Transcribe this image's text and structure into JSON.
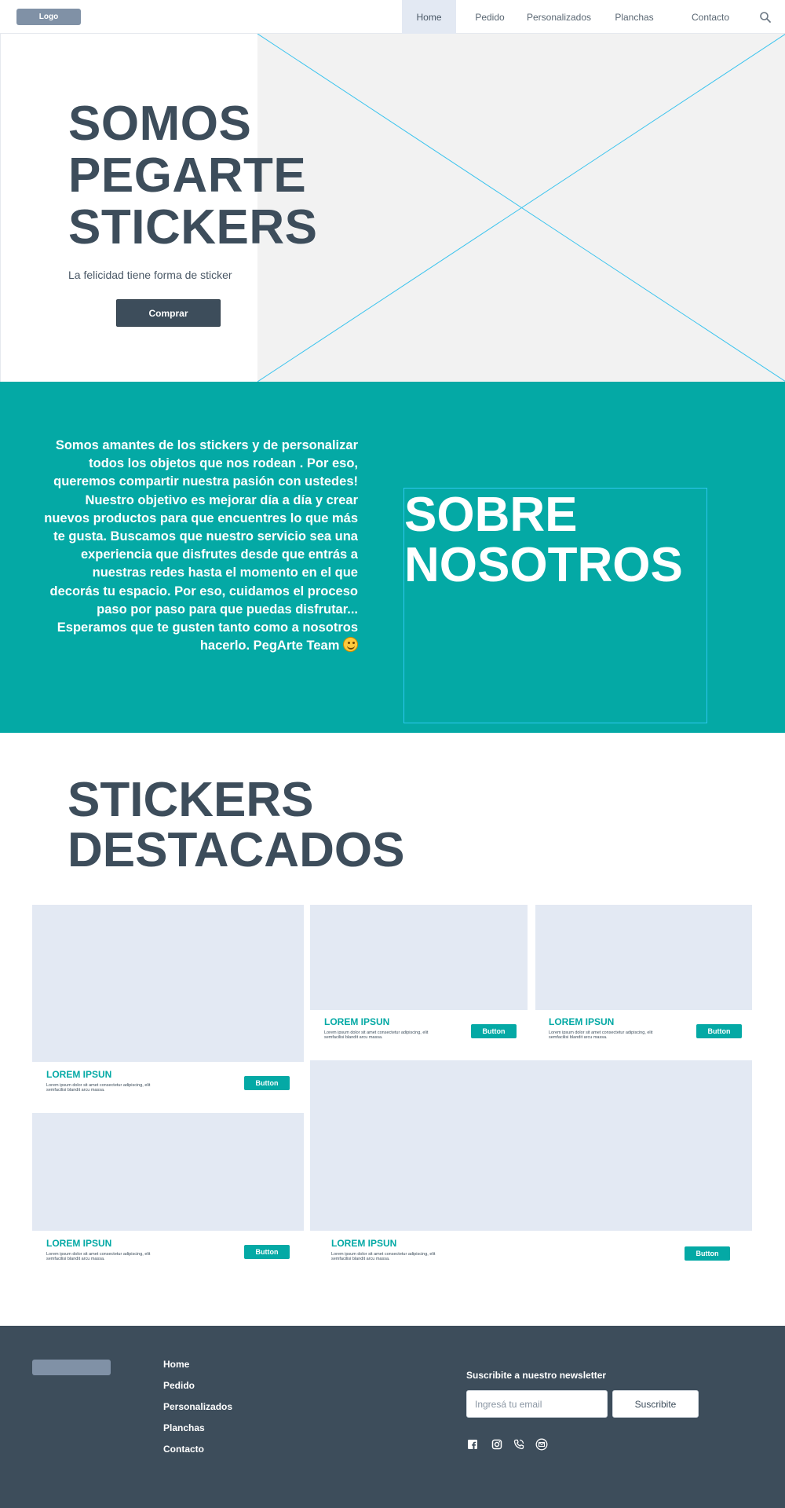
{
  "nav": {
    "logo": "Logo",
    "items": [
      {
        "label": "Home",
        "active": true
      },
      {
        "label": "Pedido",
        "active": false
      },
      {
        "label": "Personalizados",
        "active": false
      },
      {
        "label": "Planchas",
        "active": false
      },
      {
        "label": "Contacto",
        "active": false
      }
    ],
    "search_icon": "search-icon"
  },
  "hero": {
    "title_lines": [
      "SOMOS",
      "PEGARTE",
      "STICKERS"
    ],
    "subtitle": "La felicidad tiene forma de sticker",
    "button": "Comprar"
  },
  "about": {
    "text": "Somos amantes de los stickers y de personalizar todos los objetos que nos rodean . Por eso, queremos compartir nuestra pasión con ustedes! Nuestro objetivo es mejorar día a día y crear nuevos productos para que encuentres lo que más te gusta. Buscamos que nuestro servicio sea una experiencia que disfrutes desde que entrás a nuestras redes hasta el momento en el que decorás tu espacio. Por eso, cuidamos el proceso paso por paso para que puedas disfrutar... Esperamos que te gusten tanto como a nosotros hacerlo. PegArte Team",
    "title_lines": [
      "SOBRE",
      "NOSOTROS"
    ],
    "emoji_icon": "smiley-icon"
  },
  "featured": {
    "title_lines": [
      "STICKERS",
      "DESTACADOS"
    ],
    "cards": [
      {
        "title": "LOREM IPSUN",
        "desc": "Lorem ipsum dolor sit amet consectetur adipiscing, elit semfacilisi blandit arcu massa.",
        "button": "Button"
      },
      {
        "title": "LOREM IPSUN",
        "desc": "Lorem ipsum dolor sit amet consectetur adipiscing, elit semfacilisi blandit arcu massa.",
        "button": "Button"
      },
      {
        "title": "LOREM IPSUN",
        "desc": "Lorem ipsum dolor sit amet consectetur adipiscing, elit semfacilisi blandit arcu massa.",
        "button": "Button"
      },
      {
        "title": "LOREM IPSUN",
        "desc": "Lorem ipsum dolor sit amet consectetur adipiscing, elit semfacilisi blandit arcu massa.",
        "button": "Button"
      },
      {
        "title": "LOREM IPSUN",
        "desc": "Lorem ipsum dolor sit amet consectetur adipiscing, elit semfacilisi blandit arcu massa.",
        "button": "Button"
      }
    ]
  },
  "footer": {
    "links": [
      "Home",
      "Pedido",
      "Personalizados",
      "Planchas",
      "Contacto"
    ],
    "newsletter_label": "Suscribite a nuestro newsletter",
    "email_placeholder": "Ingresá tu email",
    "subscribe_button": "Suscribite",
    "social_icons": [
      "facebook-icon",
      "instagram-icon",
      "whatsapp-icon",
      "email-icon"
    ]
  },
  "colors": {
    "teal": "#04a9a5",
    "dark": "#3d4d5b",
    "placeholder": "#e3e9f3",
    "logo": "#8091a6"
  }
}
